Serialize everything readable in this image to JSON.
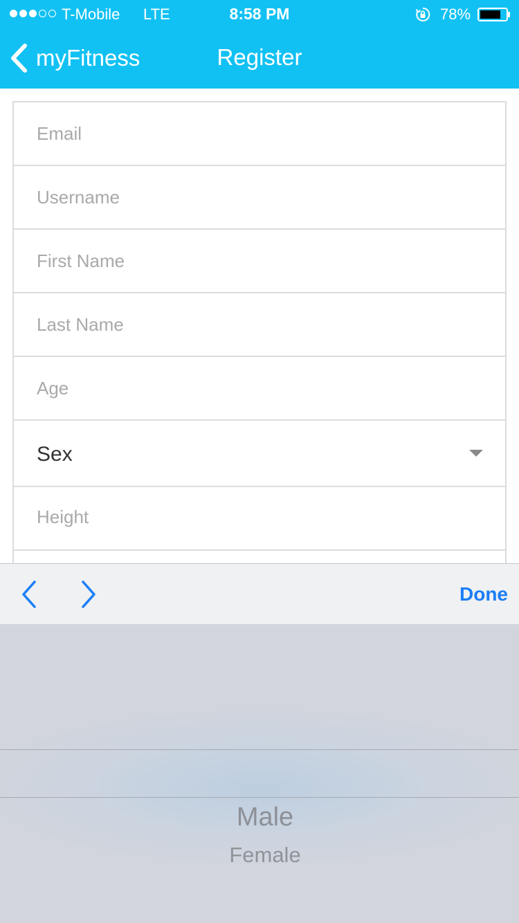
{
  "status_bar": {
    "carrier": "T-Mobile",
    "network": "LTE",
    "time": "8:58 PM",
    "battery": "78%",
    "signal_bars_filled": 3,
    "signal_bars_total": 5
  },
  "nav": {
    "back_label": "myFitness",
    "title": "Register"
  },
  "form": {
    "fields": [
      {
        "placeholder": "Email"
      },
      {
        "placeholder": "Username"
      },
      {
        "placeholder": "First Name"
      },
      {
        "placeholder": "Last Name"
      },
      {
        "placeholder": "Age"
      },
      {
        "value": "Sex"
      },
      {
        "placeholder": "Height"
      }
    ]
  },
  "toolbar": {
    "done_label": "Done"
  },
  "picker": {
    "options": [
      "Male",
      "Female"
    ]
  },
  "colors": {
    "accent": "#12c1f3",
    "toolbar_tint": "#1b7ef6"
  }
}
